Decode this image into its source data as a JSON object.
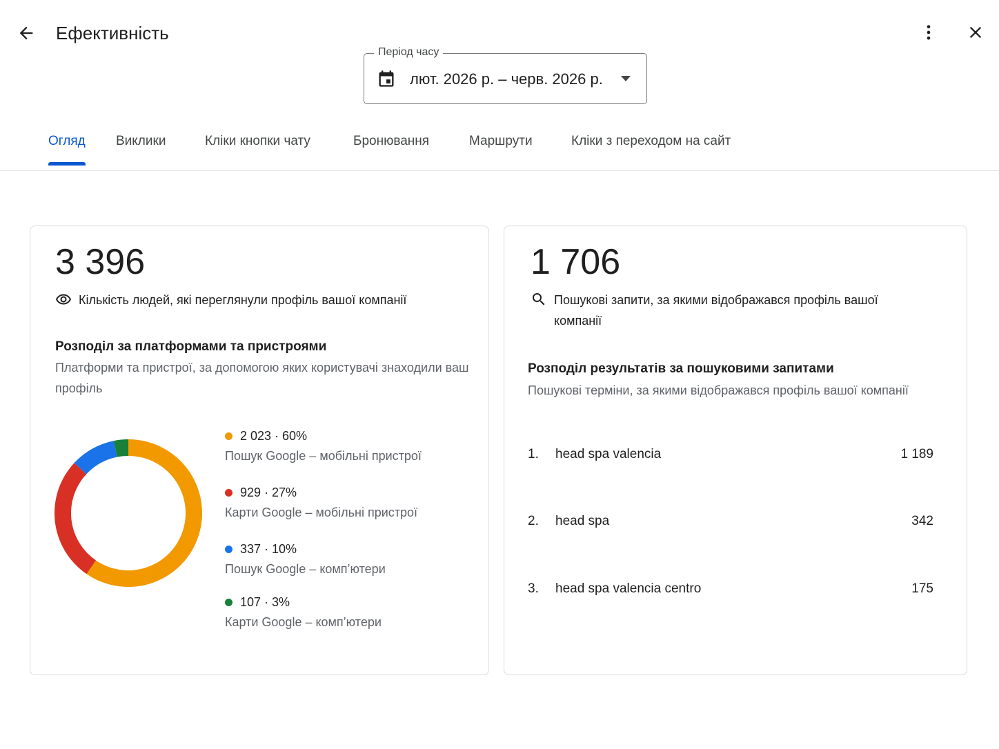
{
  "header": {
    "title": "Ефективність",
    "back_icon": "arrow-back-icon",
    "more_icon": "more-vert-icon",
    "close_icon": "close-icon"
  },
  "period": {
    "label": "Період часу",
    "value": "лют. 2026 р. – черв. 2026 р.",
    "icon": "calendar-icon"
  },
  "tabs": [
    {
      "label": "Огляд",
      "active": true
    },
    {
      "label": "Виклики",
      "active": false
    },
    {
      "label": "Кліки кнопки чату",
      "active": false
    },
    {
      "label": "Бронювання",
      "active": false
    },
    {
      "label": "Маршрути",
      "active": false
    },
    {
      "label": "Кліки з переходом на сайт",
      "active": false
    }
  ],
  "views_card": {
    "total": "3 396",
    "metric_label": "Кількість людей, які переглянули профіль вашої компанії",
    "metric_icon": "eye-icon",
    "section_title": "Розподіл за платформами та пристроями",
    "section_subtitle": "Платформи та пристрої, за допомогою яких користувачі знаходили ваш профіль"
  },
  "chart_data": {
    "type": "pie",
    "slices": [
      {
        "value": 2023,
        "percent": 60,
        "summary": "2 023 · 60%",
        "label": "Пошук Google – мобільні пристрої",
        "color": "#f29900"
      },
      {
        "value": 929,
        "percent": 27,
        "summary": "929 · 27%",
        "label": "Карти Google – мобільні пристрої",
        "color": "#d93025"
      },
      {
        "value": 337,
        "percent": 10,
        "summary": "337 · 10%",
        "label": "Пошук Google – комп’ютери",
        "color": "#1a73e8"
      },
      {
        "value": 107,
        "percent": 3,
        "summary": "107 · 3%",
        "label": "Карти Google – комп’ютери",
        "color": "#188038"
      }
    ]
  },
  "search_card": {
    "total": "1 706",
    "metric_label": "Пошукові запити, за якими відображався профіль вашої компанії",
    "metric_icon": "search-icon",
    "section_title": "Розподіл результатів за пошуковими запитами",
    "section_subtitle": "Пошукові терміни, за якими відображався профіль вашої компанії",
    "queries": [
      {
        "rank": "1.",
        "term": "head spa valencia",
        "count": "1 189"
      },
      {
        "rank": "2.",
        "term": "head spa",
        "count": "342"
      },
      {
        "rank": "3.",
        "term": "head spa valencia centro",
        "count": "175"
      }
    ]
  },
  "colors": {
    "accent": "#0b57d0",
    "text_primary": "#1f1f1f",
    "text_secondary": "#5f6368"
  }
}
